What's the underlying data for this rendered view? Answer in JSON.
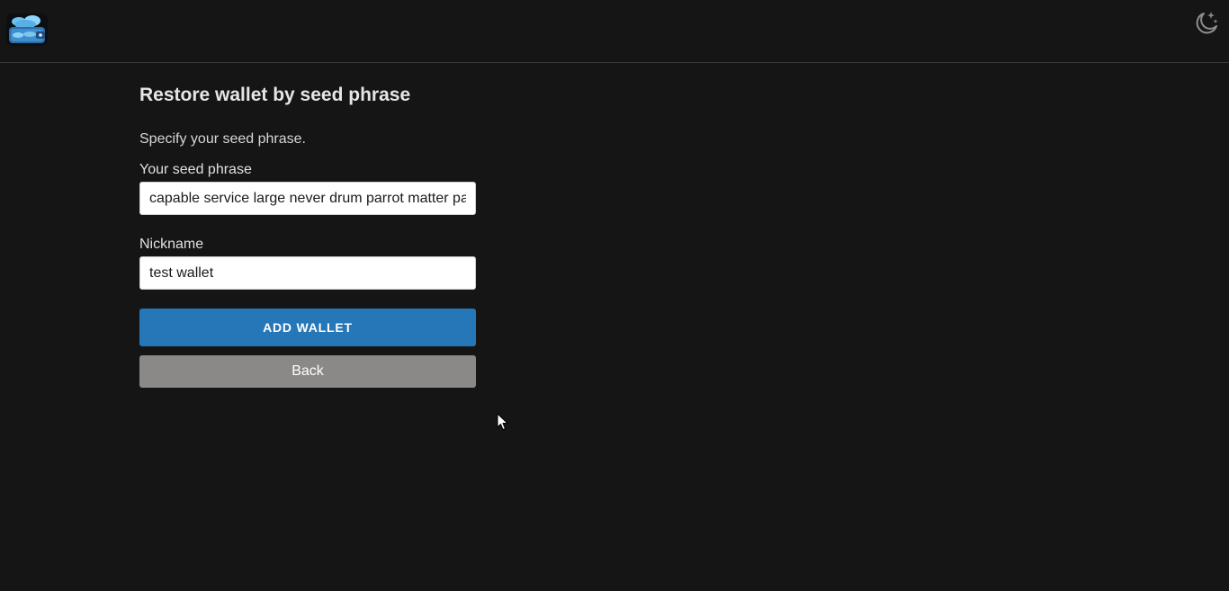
{
  "header": {
    "logo_icon": "wallet-logo-icon",
    "theme_icon": "moon-stars-icon"
  },
  "form": {
    "title": "Restore wallet by seed phrase",
    "description": "Specify your seed phrase.",
    "seed_label": "Your seed phrase",
    "seed_value": "capable service large never drum parrot matter pa",
    "nickname_label": "Nickname",
    "nickname_value": "test wallet",
    "add_button_label": "ADD WALLET",
    "back_button_label": "Back"
  },
  "colors": {
    "background": "#151515",
    "primary": "#2577b8",
    "secondary": "#8a8987"
  }
}
